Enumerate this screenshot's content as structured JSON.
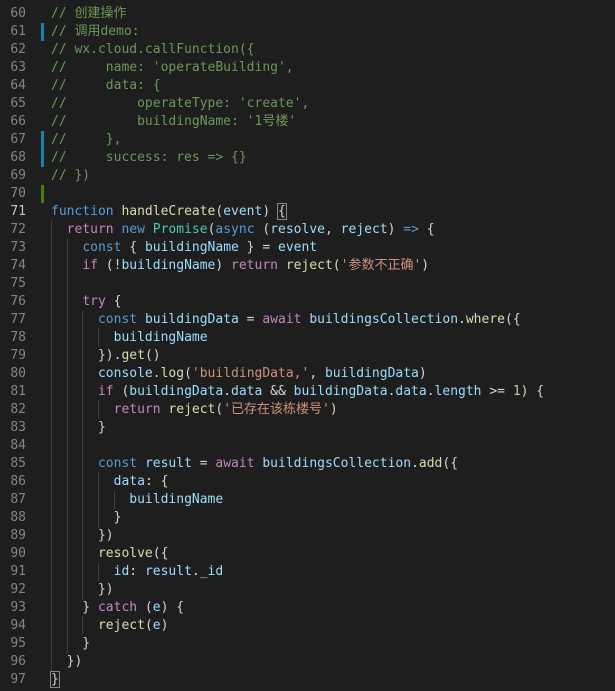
{
  "colors": {
    "background": "#1e1e1e",
    "line_number": "#858585",
    "comment": "#6a9955",
    "keyword": "#569cd6",
    "function": "#dcdcaa",
    "variable": "#9cdcfe",
    "string": "#ce9178",
    "type": "#4ec9b0",
    "number": "#b5cea8",
    "control": "#c586c0",
    "gutter_modified": "#1b81a8",
    "gutter_added": "#487e02"
  },
  "lines": [
    {
      "n": "60",
      "gutter": "",
      "tokens": [
        [
          "c",
          "// 创建操作"
        ]
      ]
    },
    {
      "n": "61",
      "gutter": "mod",
      "tokens": [
        [
          "c",
          "// 调用demo:"
        ]
      ]
    },
    {
      "n": "62",
      "gutter": "",
      "tokens": [
        [
          "c",
          "// wx.cloud.callFunction({"
        ]
      ]
    },
    {
      "n": "63",
      "gutter": "",
      "tokens": [
        [
          "c",
          "//     name: 'operateBuilding',"
        ]
      ]
    },
    {
      "n": "64",
      "gutter": "",
      "tokens": [
        [
          "c",
          "//     data: {"
        ]
      ]
    },
    {
      "n": "65",
      "gutter": "",
      "tokens": [
        [
          "c",
          "//         operateType: 'create',"
        ]
      ]
    },
    {
      "n": "66",
      "gutter": "",
      "tokens": [
        [
          "c",
          "//         buildingName: '1号楼'"
        ]
      ]
    },
    {
      "n": "67",
      "gutter": "mod",
      "tokens": [
        [
          "c",
          "//     },"
        ]
      ]
    },
    {
      "n": "68",
      "gutter": "mod",
      "tokens": [
        [
          "c",
          "//     success: res => {}"
        ]
      ]
    },
    {
      "n": "69",
      "gutter": "",
      "tokens": [
        [
          "c",
          "// })"
        ]
      ]
    },
    {
      "n": "70",
      "gutter": "add",
      "tokens": []
    },
    {
      "n": "71",
      "gutter": "",
      "active": true,
      "tokens": [
        [
          "k",
          "function"
        ],
        [
          "p",
          " "
        ],
        [
          "f",
          "handleCreate"
        ],
        [
          "p",
          "("
        ],
        [
          "v",
          "event"
        ],
        [
          "p",
          ") "
        ],
        [
          "bm",
          "{"
        ]
      ]
    },
    {
      "n": "72",
      "gutter": "",
      "tokens": [
        [
          "p",
          "  "
        ],
        [
          "ctl",
          "return"
        ],
        [
          "p",
          " "
        ],
        [
          "k",
          "new"
        ],
        [
          "p",
          " "
        ],
        [
          "t",
          "Promise"
        ],
        [
          "p",
          "("
        ],
        [
          "k",
          "async"
        ],
        [
          "p",
          " ("
        ],
        [
          "v",
          "resolve"
        ],
        [
          "p",
          ", "
        ],
        [
          "v",
          "reject"
        ],
        [
          "p",
          ") "
        ],
        [
          "k",
          "=>"
        ],
        [
          "p",
          " {"
        ]
      ]
    },
    {
      "n": "73",
      "gutter": "",
      "tokens": [
        [
          "p",
          "    "
        ],
        [
          "k",
          "const"
        ],
        [
          "p",
          " { "
        ],
        [
          "v",
          "buildingName"
        ],
        [
          "p",
          " } = "
        ],
        [
          "v",
          "event"
        ]
      ]
    },
    {
      "n": "74",
      "gutter": "",
      "tokens": [
        [
          "p",
          "    "
        ],
        [
          "ctl",
          "if"
        ],
        [
          "p",
          " (!"
        ],
        [
          "v",
          "buildingName"
        ],
        [
          "p",
          ") "
        ],
        [
          "ctl",
          "return"
        ],
        [
          "p",
          " "
        ],
        [
          "f",
          "reject"
        ],
        [
          "p",
          "("
        ],
        [
          "s",
          "'参数不正确'"
        ],
        [
          "p",
          ")"
        ]
      ]
    },
    {
      "n": "75",
      "gutter": "",
      "tokens": []
    },
    {
      "n": "76",
      "gutter": "",
      "tokens": [
        [
          "p",
          "    "
        ],
        [
          "ctl",
          "try"
        ],
        [
          "p",
          " {"
        ]
      ]
    },
    {
      "n": "77",
      "gutter": "",
      "tokens": [
        [
          "p",
          "      "
        ],
        [
          "k",
          "const"
        ],
        [
          "p",
          " "
        ],
        [
          "v",
          "buildingData"
        ],
        [
          "p",
          " = "
        ],
        [
          "ctl",
          "await"
        ],
        [
          "p",
          " "
        ],
        [
          "v",
          "buildingsCollection"
        ],
        [
          "p",
          "."
        ],
        [
          "f",
          "where"
        ],
        [
          "p",
          "({"
        ]
      ]
    },
    {
      "n": "78",
      "gutter": "",
      "tokens": [
        [
          "p",
          "        "
        ],
        [
          "v",
          "buildingName"
        ]
      ]
    },
    {
      "n": "79",
      "gutter": "",
      "tokens": [
        [
          "p",
          "      })."
        ],
        [
          "f",
          "get"
        ],
        [
          "p",
          "()"
        ]
      ]
    },
    {
      "n": "80",
      "gutter": "",
      "tokens": [
        [
          "p",
          "      "
        ],
        [
          "v",
          "console"
        ],
        [
          "p",
          "."
        ],
        [
          "f",
          "log"
        ],
        [
          "p",
          "("
        ],
        [
          "s",
          "'buildingData,'"
        ],
        [
          "p",
          ", "
        ],
        [
          "v",
          "buildingData"
        ],
        [
          "p",
          ")"
        ]
      ]
    },
    {
      "n": "81",
      "gutter": "",
      "tokens": [
        [
          "p",
          "      "
        ],
        [
          "ctl",
          "if"
        ],
        [
          "p",
          " ("
        ],
        [
          "v",
          "buildingData"
        ],
        [
          "p",
          "."
        ],
        [
          "v",
          "data"
        ],
        [
          "p",
          " && "
        ],
        [
          "v",
          "buildingData"
        ],
        [
          "p",
          "."
        ],
        [
          "v",
          "data"
        ],
        [
          "p",
          "."
        ],
        [
          "v",
          "length"
        ],
        [
          "p",
          " >= "
        ],
        [
          "n",
          "1"
        ],
        [
          "p",
          ") {"
        ]
      ]
    },
    {
      "n": "82",
      "gutter": "",
      "tokens": [
        [
          "p",
          "        "
        ],
        [
          "ctl",
          "return"
        ],
        [
          "p",
          " "
        ],
        [
          "f",
          "reject"
        ],
        [
          "p",
          "("
        ],
        [
          "s",
          "'已存在该栋楼号'"
        ],
        [
          "p",
          ")"
        ]
      ]
    },
    {
      "n": "83",
      "gutter": "",
      "tokens": [
        [
          "p",
          "      }"
        ]
      ]
    },
    {
      "n": "84",
      "gutter": "",
      "tokens": []
    },
    {
      "n": "85",
      "gutter": "",
      "tokens": [
        [
          "p",
          "      "
        ],
        [
          "k",
          "const"
        ],
        [
          "p",
          " "
        ],
        [
          "v",
          "result"
        ],
        [
          "p",
          " = "
        ],
        [
          "ctl",
          "await"
        ],
        [
          "p",
          " "
        ],
        [
          "v",
          "buildingsCollection"
        ],
        [
          "p",
          "."
        ],
        [
          "f",
          "add"
        ],
        [
          "p",
          "({"
        ]
      ]
    },
    {
      "n": "86",
      "gutter": "",
      "tokens": [
        [
          "p",
          "        "
        ],
        [
          "v",
          "data"
        ],
        [
          "p",
          ": {"
        ]
      ]
    },
    {
      "n": "87",
      "gutter": "",
      "tokens": [
        [
          "p",
          "          "
        ],
        [
          "v",
          "buildingName"
        ]
      ]
    },
    {
      "n": "88",
      "gutter": "",
      "tokens": [
        [
          "p",
          "        }"
        ]
      ]
    },
    {
      "n": "89",
      "gutter": "",
      "tokens": [
        [
          "p",
          "      })"
        ]
      ]
    },
    {
      "n": "90",
      "gutter": "",
      "tokens": [
        [
          "p",
          "      "
        ],
        [
          "f",
          "resolve"
        ],
        [
          "p",
          "({"
        ]
      ]
    },
    {
      "n": "91",
      "gutter": "",
      "tokens": [
        [
          "p",
          "        "
        ],
        [
          "v",
          "id"
        ],
        [
          "p",
          ": "
        ],
        [
          "v",
          "result"
        ],
        [
          "p",
          "."
        ],
        [
          "v",
          "_id"
        ]
      ]
    },
    {
      "n": "92",
      "gutter": "",
      "tokens": [
        [
          "p",
          "      })"
        ]
      ]
    },
    {
      "n": "93",
      "gutter": "",
      "tokens": [
        [
          "p",
          "    } "
        ],
        [
          "ctl",
          "catch"
        ],
        [
          "p",
          " ("
        ],
        [
          "v",
          "e"
        ],
        [
          "p",
          ") {"
        ]
      ]
    },
    {
      "n": "94",
      "gutter": "",
      "tokens": [
        [
          "p",
          "      "
        ],
        [
          "f",
          "reject"
        ],
        [
          "p",
          "("
        ],
        [
          "v",
          "e"
        ],
        [
          "p",
          ")"
        ]
      ]
    },
    {
      "n": "95",
      "gutter": "",
      "tokens": [
        [
          "p",
          "    }"
        ]
      ]
    },
    {
      "n": "96",
      "gutter": "",
      "tokens": [
        [
          "p",
          "  })"
        ]
      ]
    },
    {
      "n": "97",
      "gutter": "",
      "tokens": [
        [
          "bm",
          "}"
        ]
      ]
    }
  ]
}
